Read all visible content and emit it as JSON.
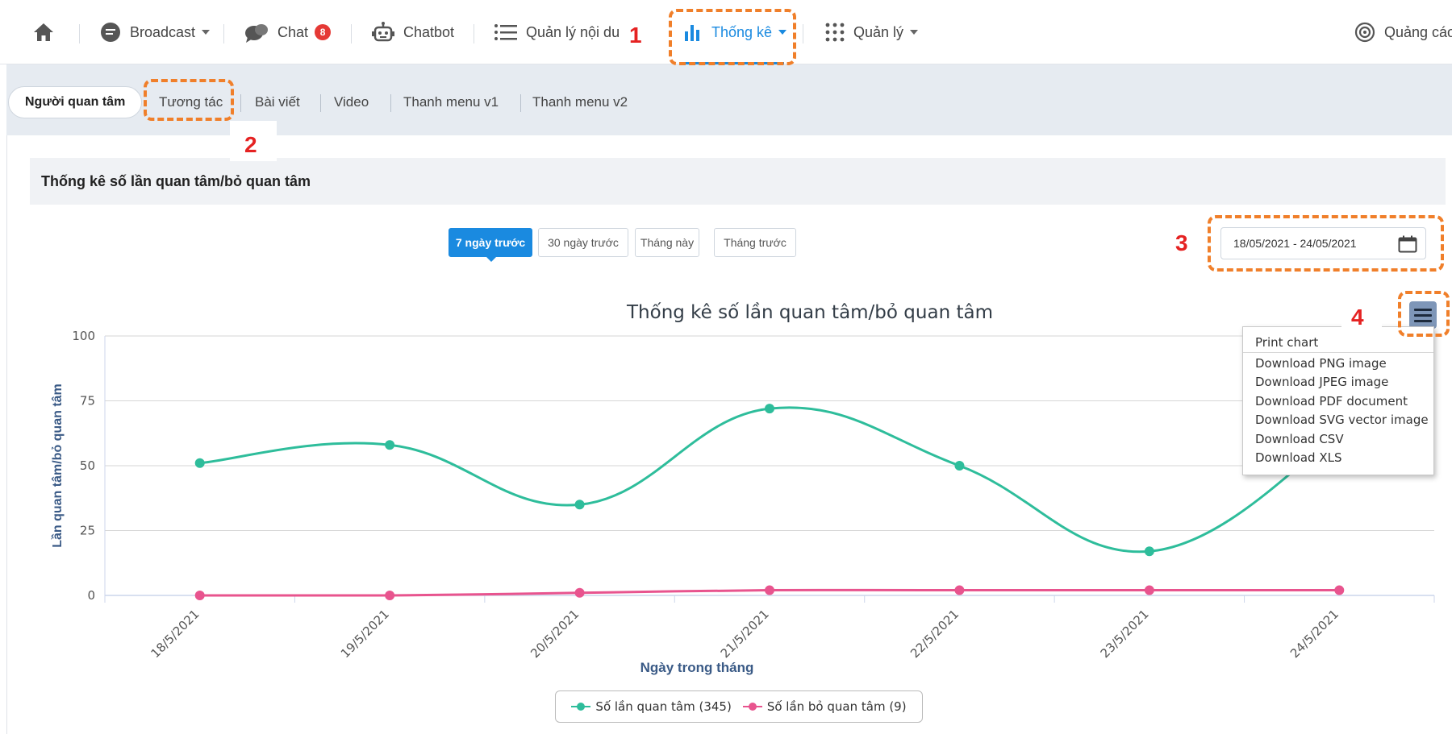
{
  "nav": {
    "broadcast": "Broadcast",
    "chat": "Chat",
    "chat_badge": "8",
    "chatbot": "Chatbot",
    "content_mgmt": "Quản lý nội du",
    "stats": "Thống kê",
    "manage": "Quản lý",
    "ads": "Quảng cáo",
    "active_color": "#1a8ae0"
  },
  "tabs": [
    "Người quan tâm",
    "Tương tác",
    "Bài viết",
    "Video",
    "Thanh menu v1",
    "Thanh menu v2"
  ],
  "section_title": "Thống kê số lần quan tâm/bỏ quan tâm",
  "range_buttons": [
    "7 ngày trước",
    "30 ngày trước",
    "Tháng này",
    "Tháng trước"
  ],
  "active_range": "7 ngày trước",
  "date_range": "18/05/2021 - 24/05/2021",
  "annotations": [
    "1",
    "2",
    "3",
    "4"
  ],
  "export_menu": [
    "Print chart",
    "Download PNG image",
    "Download JPEG image",
    "Download PDF document",
    "Download SVG vector image",
    "Download CSV",
    "Download XLS"
  ],
  "chart_data": {
    "type": "line",
    "title": "Thống kê số lần quan tâm/bỏ quan tâm",
    "xlabel": "Ngày trong tháng",
    "ylabel": "Lần quan tâm/bỏ quan tâm",
    "categories": [
      "18/5/2021",
      "19/5/2021",
      "20/5/2021",
      "21/5/2021",
      "22/5/2021",
      "23/5/2021",
      "24/5/2021"
    ],
    "ylim": [
      0,
      100
    ],
    "yticks": [
      0,
      25,
      50,
      75,
      100
    ],
    "grid": true,
    "legend_position": "bottom",
    "series": [
      {
        "name": "Số lần quan tâm (345)",
        "values": [
          51,
          58,
          35,
          72,
          50,
          17,
          62
        ],
        "color": "#2ebd9b"
      },
      {
        "name": "Số lần bỏ quan tâm (9)",
        "values": [
          0,
          0,
          1,
          2,
          2,
          2,
          2
        ],
        "color": "#e8548e"
      }
    ]
  }
}
